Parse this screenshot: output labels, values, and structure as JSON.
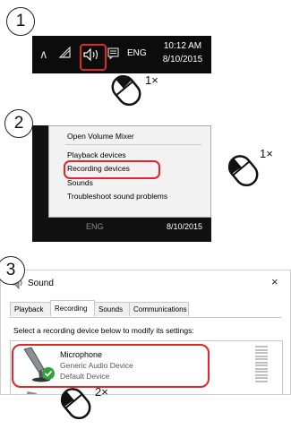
{
  "steps": [
    {
      "number": "1",
      "click_count": "1×"
    },
    {
      "number": "2",
      "click_count": "1×"
    },
    {
      "number": "3",
      "click_count": "2×"
    }
  ],
  "taskbar": {
    "icons": [
      "chevron-up-icon",
      "network-wifi-icon",
      "speaker-icon",
      "action-center-icon"
    ],
    "language": "ENG",
    "time": "10:12 AM",
    "date": "8/10/2015"
  },
  "context_menu": {
    "items": [
      "Open Volume Mixer",
      "Playback devices",
      "Recording devices",
      "Sounds",
      "Troubleshoot sound problems"
    ],
    "behind_language": "ENG",
    "behind_date": "8/10/2015"
  },
  "dialog": {
    "title": "Sound",
    "close_glyph": "×",
    "tabs": [
      "Playback",
      "Recording",
      "Sounds",
      "Communications"
    ],
    "active_tab": "Recording",
    "instruction": "Select a recording device below to modify its settings:",
    "device": {
      "name": "Microphone",
      "description": "Generic Audio Device",
      "status": "Default Device",
      "status_color": "#2fa33a"
    }
  },
  "colors": {
    "highlight": "#e0262a",
    "taskbar": "#0c0c0c"
  }
}
